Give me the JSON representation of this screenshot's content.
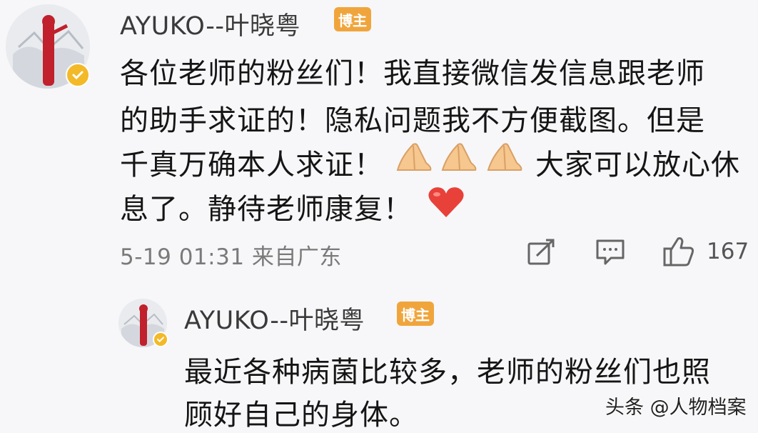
{
  "comment": {
    "avatar_icon": "avatar-icon",
    "username": "AYUKO--叶晓粤",
    "badge": "博主",
    "lines": [
      "各位老师的粉丝们！我直接微信发信息跟老师",
      "的助手求证的！隐私问题我不方便截图。但是",
      "千真万确本人求证！",
      "大家可以放心休",
      "息了。静待老师康复！"
    ],
    "emoji": [
      "folded-hands-emoji",
      "folded-hands-emoji",
      "folded-hands-emoji",
      "red-heart-emoji"
    ],
    "timestamp": "5-19 01:31 来自广东",
    "actions": {
      "share_icon": "share-icon",
      "comment_icon": "comment-icon",
      "like_icon": "thumbs-up-icon",
      "like_count": "167"
    }
  },
  "reply": {
    "avatar_icon": "avatar-icon",
    "username": "AYUKO--叶晓粤",
    "badge": "博主",
    "lines": [
      "最近各种病菌比较多，老师的粉丝们也照",
      "顾好自己的身体。"
    ]
  },
  "watermark": "头条 @人物档案",
  "colors": {
    "badge_orange": "#f0a53c",
    "verified_yellow": "#f3b928",
    "heart_red": "#e8413a",
    "background": "#f7f7f9"
  }
}
